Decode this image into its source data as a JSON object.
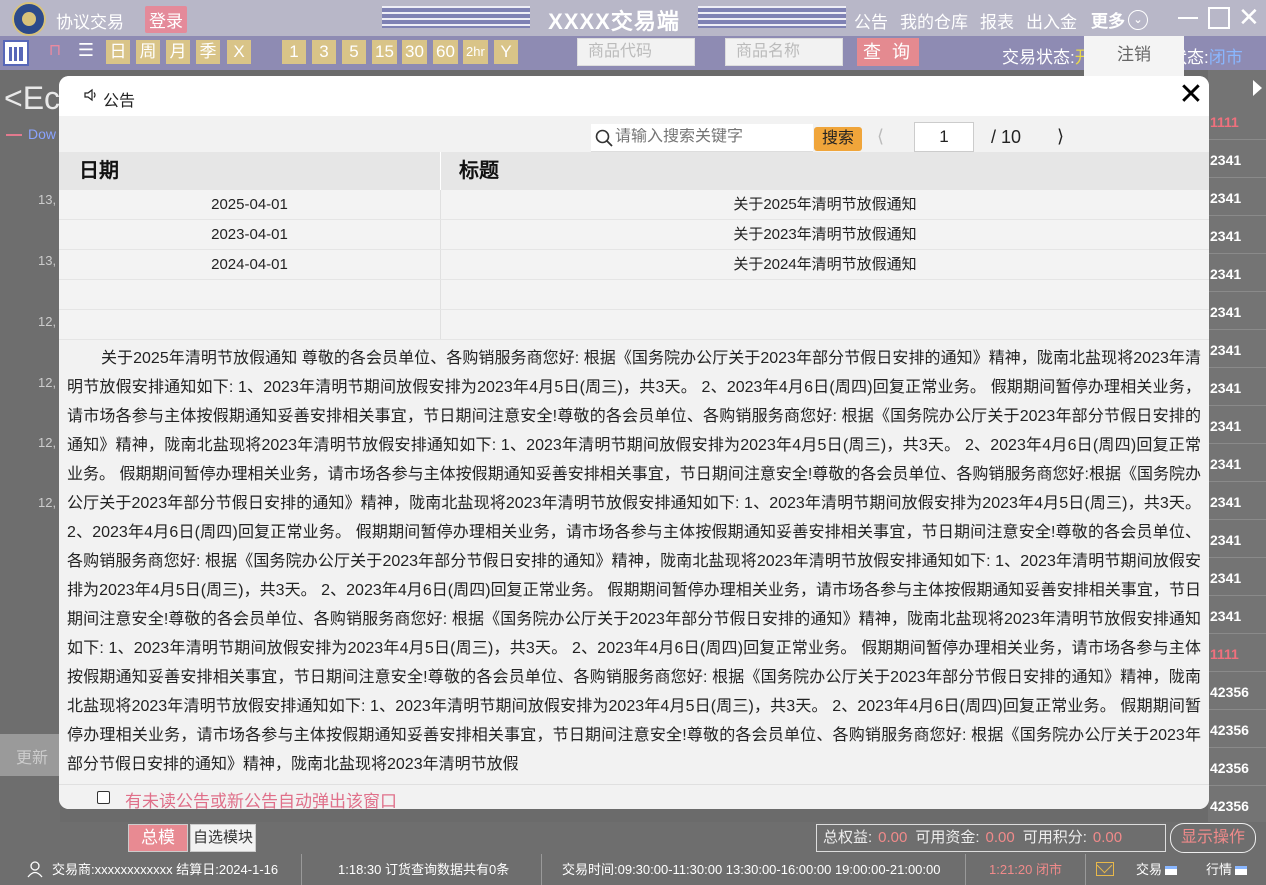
{
  "titlebar": {
    "app_name": "协议交易",
    "login": "登录",
    "title": "XXXX交易端",
    "menu": [
      "公告",
      "我的仓库",
      "报表",
      "出入金"
    ],
    "more": "更多"
  },
  "toolbar": {
    "periods": [
      "日",
      "周",
      "月",
      "季",
      "X"
    ],
    "minutes": [
      "1",
      "3",
      "5",
      "15",
      "30",
      "60",
      "2hr",
      "Y"
    ],
    "code_placeholder": "商品代码",
    "name_placeholder": "商品名称",
    "query": "查 询",
    "trade_status_label": "交易状态:",
    "trade_status_value": "开",
    "market_status_label": "状态:",
    "market_status_value": "闭市",
    "logout": "注销"
  },
  "background": {
    "ec": "<Ec",
    "dow": "Dow",
    "y_labels": [
      "13,",
      "13,",
      "12,",
      "12,",
      "12,",
      "12,"
    ],
    "refresh": "更新",
    "right_cells": [
      "1111",
      "2341",
      "2341",
      "2341",
      "2341",
      "2341",
      "2341",
      "2341",
      "2341",
      "2341",
      "2341",
      "2341",
      "2341",
      "2341",
      "",
      "1111",
      "42356",
      "42356",
      "42356",
      "42356"
    ]
  },
  "modal": {
    "title": "公告",
    "search_placeholder": "请输入搜索关键字",
    "search_btn": "搜索",
    "page_current": "1",
    "page_total": "/  10",
    "columns": [
      "日期",
      "标题"
    ],
    "rows": [
      {
        "date": "2025-04-01",
        "title": "关于2025年清明节放假通知"
      },
      {
        "date": "2023-04-01",
        "title": "关于2023年清明节放假通知"
      },
      {
        "date": "2024-04-01",
        "title": "关于2024年清明节放假通知"
      },
      {
        "date": "",
        "title": ""
      },
      {
        "date": "",
        "title": ""
      }
    ],
    "content": "关于2025年清明节放假通知 尊敬的各会员单位、各购销服务商您好: 根据《国务院办公厅关于2023年部分节假日安排的通知》精神，陇南北盐现将2023年清明节放假安排通知如下: 1、2023年清明节期间放假安排为2023年4月5日(周三)，共3天。 2、2023年4月6日(周四)回复正常业务。 假期期间暂停办理相关业务，请市场各参与主体按假期通知妥善安排相关事宜，节日期间注意安全!尊敬的各会员单位、各购销服务商您好: 根据《国务院办公厅关于2023年部分节假日安排的通知》精神，陇南北盐现将2023年清明节放假安排通知如下: 1、2023年清明节期间放假安排为2023年4月5日(周三)，共3天。 2、2023年4月6日(周四)回复正常业务。 假期期间暂停办理相关业务，请市场各参与主体按假期通知妥善安排相关事宜，节日期间注意安全!尊敬的各会员单位、各购销服务商您好:根据《国务院办公厅关于2023年部分节假日安排的通知》精神，陇南北盐现将2023年清明节放假安排通知如下: 1、2023年清明节期间放假安排为2023年4月5日(周三)，共3天。 2、2023年4月6日(周四)回复正常业务。 假期期间暂停办理相关业务，请市场各参与主体按假期通知妥善安排相关事宜，节日期间注意安全!尊敬的各会员单位、各购销服务商您好: 根据《国务院办公厅关于2023年部分节假日安排的通知》精神，陇南北盐现将2023年清明节放假安排通知如下: 1、2023年清明节期间放假安排为2023年4月5日(周三)，共3天。 2、2023年4月6日(周四)回复正常业务。 假期期间暂停办理相关业务，请市场各参与主体按假期通知妥善安排相关事宜，节日期间注意安全!尊敬的各会员单位、各购销服务商您好: 根据《国务院办公厅关于2023年部分节假日安排的通知》精神，陇南北盐现将2023年清明节放假安排通知如下: 1、2023年清明节期间放假安排为2023年4月5日(周三)，共3天。 2、2023年4月6日(周四)回复正常业务。 假期期间暂停办理相关业务，请市场各参与主体按假期通知妥善安排相关事宜，节日期间注意安全!尊敬的各会员单位、各购销服务商您好: 根据《国务院办公厅关于2023年部分节假日安排的通知》精神，陇南北盐现将2023年清明节放假安排通知如下: 1、2023年清明节期间放假安排为2023年4月5日(周三)，共3天。 2、2023年4月6日(周四)回复正常业务。 假期期间暂停办理相关业务，请市场各参与主体按假期通知妥善安排相关事宜，节日期间注意安全!尊敬的各会员单位、各购销服务商您好: 根据《国务院办公厅关于2023年部分节假日安排的通知》精神，陇南北盐现将2023年清明节放假",
    "auto_popup_label": "有未读公告或新公告自动弹出该窗口"
  },
  "bottom": {
    "tab_zongmo": "总模",
    "tab_zixuan": "自选模块",
    "equity_label": "总权益:",
    "equity_value": "0.00",
    "funds_label": "可用资金:",
    "funds_value": "0.00",
    "points_label": "可用积分:",
    "points_value": "0.00",
    "show_op": "显示操作"
  },
  "statusbar": {
    "user": "交易商:xxxxxxxxxxxx 结算日:2024-1-16",
    "order": "1:18:30 订货查询数据共有0条",
    "time": "交易时间:09:30:00-11:30:00 13:30:00-16:00:00 19:00:00-21:00:00",
    "clock": "1:21:20 闭市",
    "trade": "交易",
    "quote": "行情"
  }
}
